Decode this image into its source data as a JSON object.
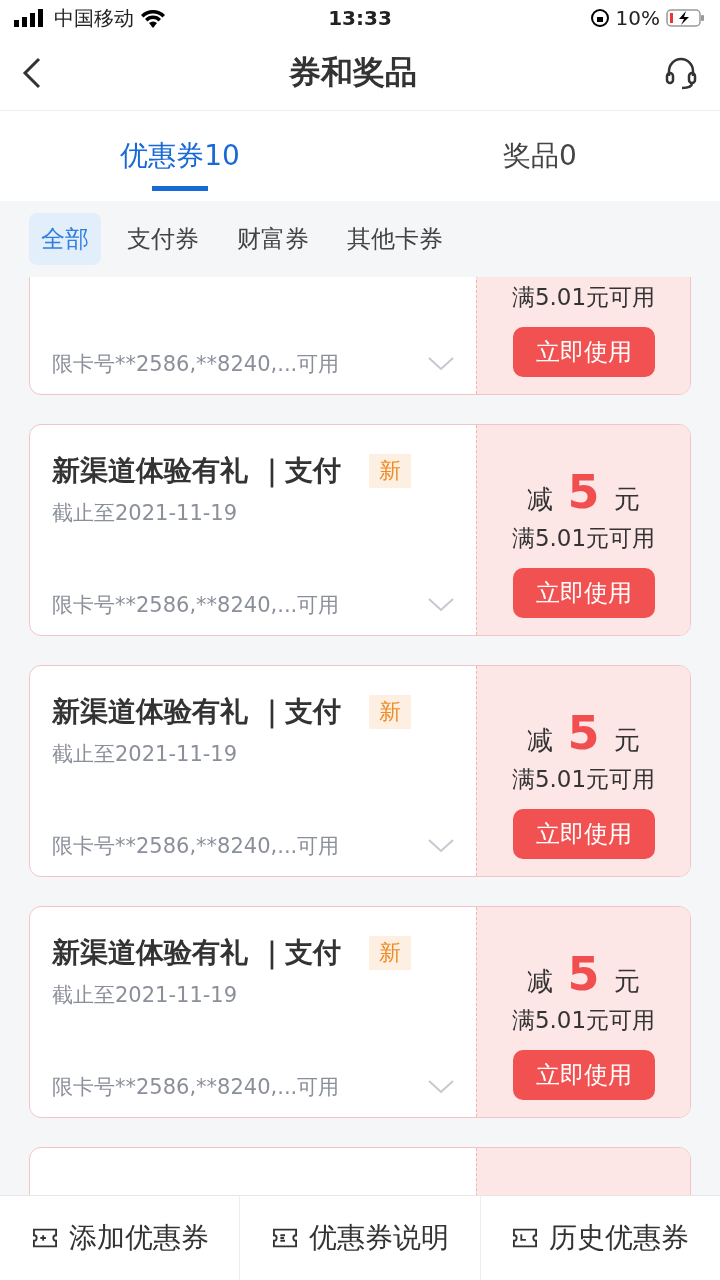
{
  "status_bar": {
    "carrier": "中国移动",
    "time": "13:33",
    "battery": "10%"
  },
  "nav": {
    "title": "券和奖品"
  },
  "tabs": [
    {
      "label": "优惠券10",
      "selected": true
    },
    {
      "label": "奖品0",
      "selected": false
    }
  ],
  "filters": [
    {
      "label": "全部",
      "selected": true
    },
    {
      "label": "支付券",
      "selected": false
    },
    {
      "label": "财富券",
      "selected": false
    },
    {
      "label": "其他卡券",
      "selected": false
    }
  ],
  "coupons": [
    {
      "condition": "满5.01元可用",
      "button": "立即使用",
      "restriction": "限卡号**2586,**8240,...可用"
    },
    {
      "title": "新渠道体验有礼 ｜支付",
      "badge": "新",
      "deadline": "截止至2021-11-19",
      "amount": {
        "prefix": "减",
        "value": "5",
        "suffix": "元"
      },
      "condition": "满5.01元可用",
      "button": "立即使用",
      "restriction": "限卡号**2586,**8240,...可用"
    },
    {
      "title": "新渠道体验有礼 ｜支付",
      "badge": "新",
      "deadline": "截止至2021-11-19",
      "amount": {
        "prefix": "减",
        "value": "5",
        "suffix": "元"
      },
      "condition": "满5.01元可用",
      "button": "立即使用",
      "restriction": "限卡号**2586,**8240,...可用"
    },
    {
      "title": "新渠道体验有礼 ｜支付",
      "badge": "新",
      "deadline": "截止至2021-11-19",
      "amount": {
        "prefix": "减",
        "value": "5",
        "suffix": "元"
      },
      "condition": "满5.01元可用",
      "button": "立即使用",
      "restriction": "限卡号**2586,**8240,...可用"
    }
  ],
  "bottom_bar": [
    {
      "label": "添加优惠券",
      "kind": "add"
    },
    {
      "label": "优惠券说明",
      "kind": "info"
    },
    {
      "label": "历史优惠券",
      "kind": "history"
    }
  ]
}
